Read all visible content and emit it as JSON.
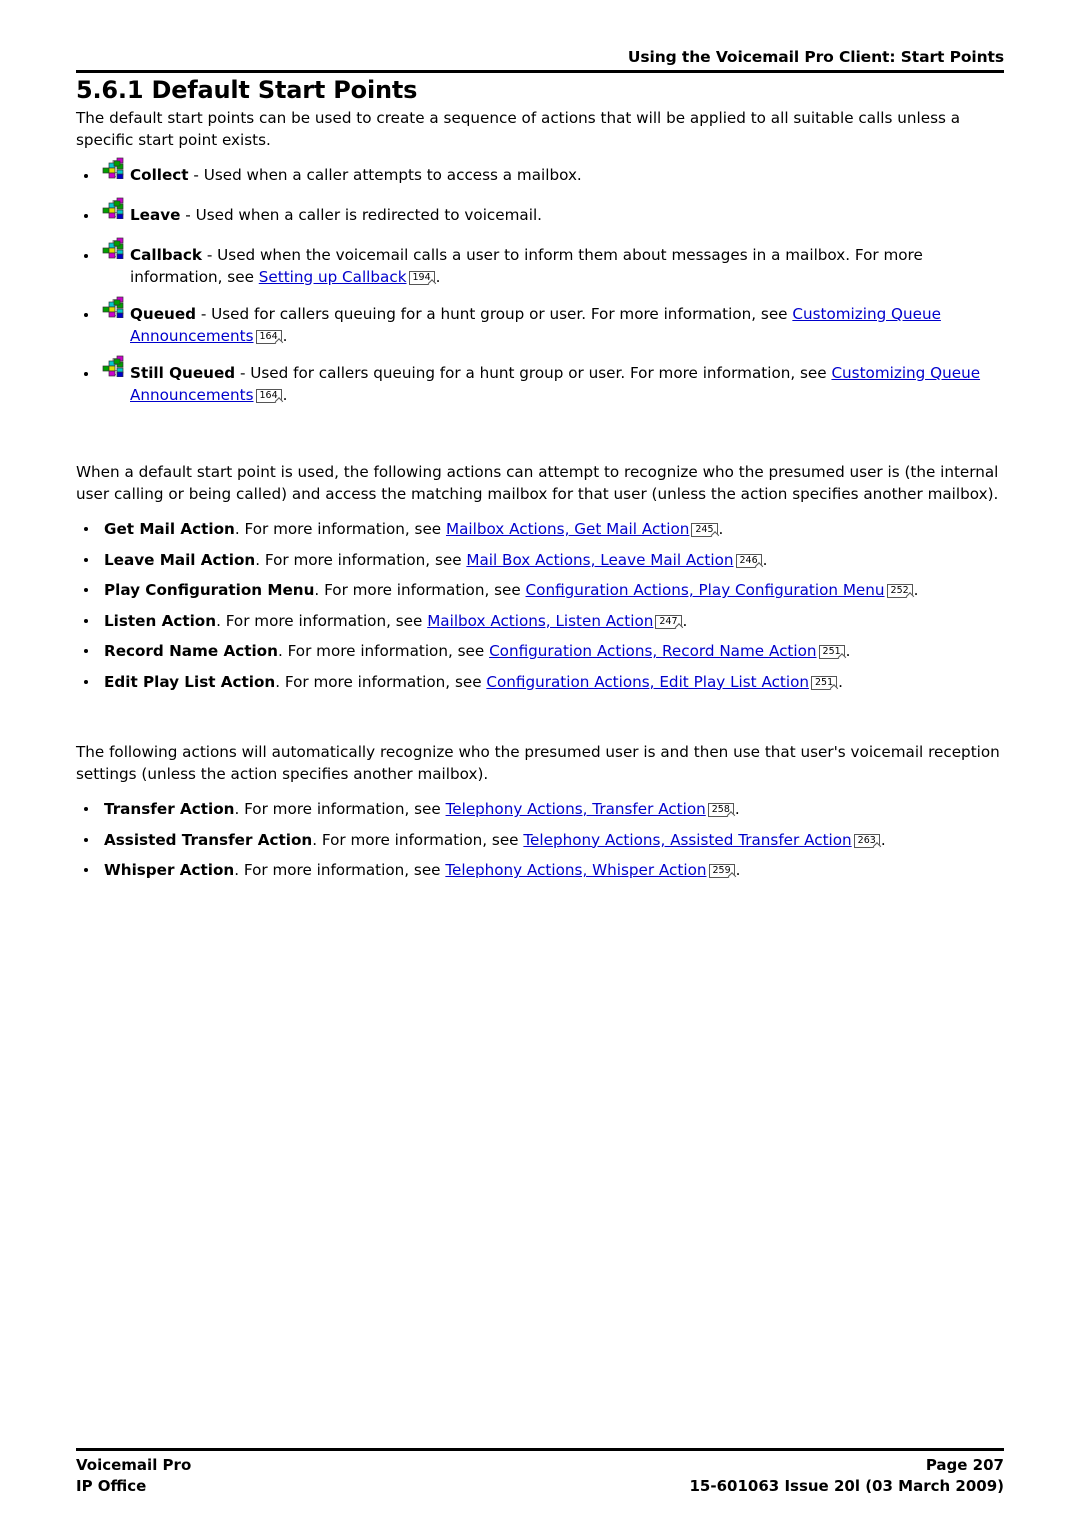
{
  "header": {
    "title": "Using the Voicemail Pro Client: Start Points"
  },
  "section": {
    "heading": "5.6.1 Default Start Points",
    "intro": "The default start points can be used to create a sequence of actions that will be applied to all suitable calls unless a specific start point exists."
  },
  "start_points": [
    {
      "icon": "start-point-tree-icon",
      "name": "Collect",
      "text": " - Used when a caller attempts to access a mailbox.",
      "link": "",
      "pgref": "",
      "tail": ""
    },
    {
      "icon": "start-point-tree-icon",
      "name": "Leave",
      "text": " - Used when a caller is redirected to voicemail.",
      "link": "",
      "pgref": "",
      "tail": ""
    },
    {
      "icon": "start-point-tree-icon",
      "name": "Callback",
      "text": " - Used when the voicemail calls a user to inform them about messages in a mailbox. For more information, see ",
      "link": "Setting up Callback",
      "pgref": "194",
      "tail": "."
    },
    {
      "icon": "start-point-tree-icon",
      "name": "Queued",
      "text": "  - Used for callers queuing for a hunt group or user. For more information, see ",
      "link": "Customizing Queue Announcements",
      "pgref": "164",
      "tail": "."
    },
    {
      "icon": "start-point-tree-icon",
      "name": "Still Queued",
      "text": " - Used for callers queuing for a hunt group or user. For more information, see ",
      "link": "Customizing Queue Announcements",
      "pgref": "164",
      "tail": "."
    }
  ],
  "recognize_para": "When a default start point is used, the following actions can attempt to recognize who the presumed user is (the internal user calling or being called) and access the matching mailbox for that user (unless the action specifies another mailbox).",
  "recognize_actions": [
    {
      "name": "Get Mail Action",
      "text": ". For more information, see ",
      "link": "Mailbox Actions, Get Mail Action",
      "pgref": "245",
      "tail": "."
    },
    {
      "name": "Leave Mail Action",
      "text": ". For more information, see ",
      "link": "Mail Box Actions, Leave Mail Action",
      "pgref": "246",
      "tail": "."
    },
    {
      "name": "Play Configuration Menu",
      "text": ". For more information, see ",
      "link": "Configuration Actions, Play Configuration Menu",
      "pgref": "252",
      "tail": "."
    },
    {
      "name": "Listen Action",
      "text": ". For more information, see ",
      "link": "Mailbox Actions, Listen Action",
      "pgref": "247",
      "tail": "."
    },
    {
      "name": "Record Name Action",
      "text": ". For more information, see ",
      "link": "Configuration Actions, Record Name Action",
      "pgref": "251",
      "tail": "."
    },
    {
      "name": "Edit Play List Action",
      "text": ". For more information, see ",
      "link": "Configuration Actions, Edit Play List Action",
      "pgref": "251",
      "tail": "."
    }
  ],
  "auto_para": "The following actions will automatically recognize who the presumed user is and then use that user's voicemail reception settings (unless the action specifies another mailbox).",
  "auto_actions": [
    {
      "name": "Transfer Action",
      "text": ". For more information, see ",
      "link": "Telephony Actions, Transfer Action",
      "pgref": "258",
      "tail": "."
    },
    {
      "name": "Assisted Transfer Action",
      "text": ". For more information, see ",
      "link": "Telephony Actions, Assisted Transfer Action",
      "pgref": "263",
      "tail": "."
    },
    {
      "name": "Whisper Action",
      "text": ". For more information, see ",
      "link": "Telephony Actions, Whisper Action",
      "pgref": "259",
      "tail": "."
    }
  ],
  "footer": {
    "product": "Voicemail Pro",
    "system": "IP Office",
    "page": "Page 207",
    "docid": "15-601063 Issue 20l (03 March 2009)"
  },
  "colors": {
    "link": "#0000cc",
    "text": "#000000",
    "rule": "#000000",
    "icon_green": "#00a000",
    "icon_cyan": "#00c8c8",
    "icon_magenta": "#cc00cc",
    "icon_yellow": "#e0e000",
    "icon_blue": "#0000c8"
  }
}
